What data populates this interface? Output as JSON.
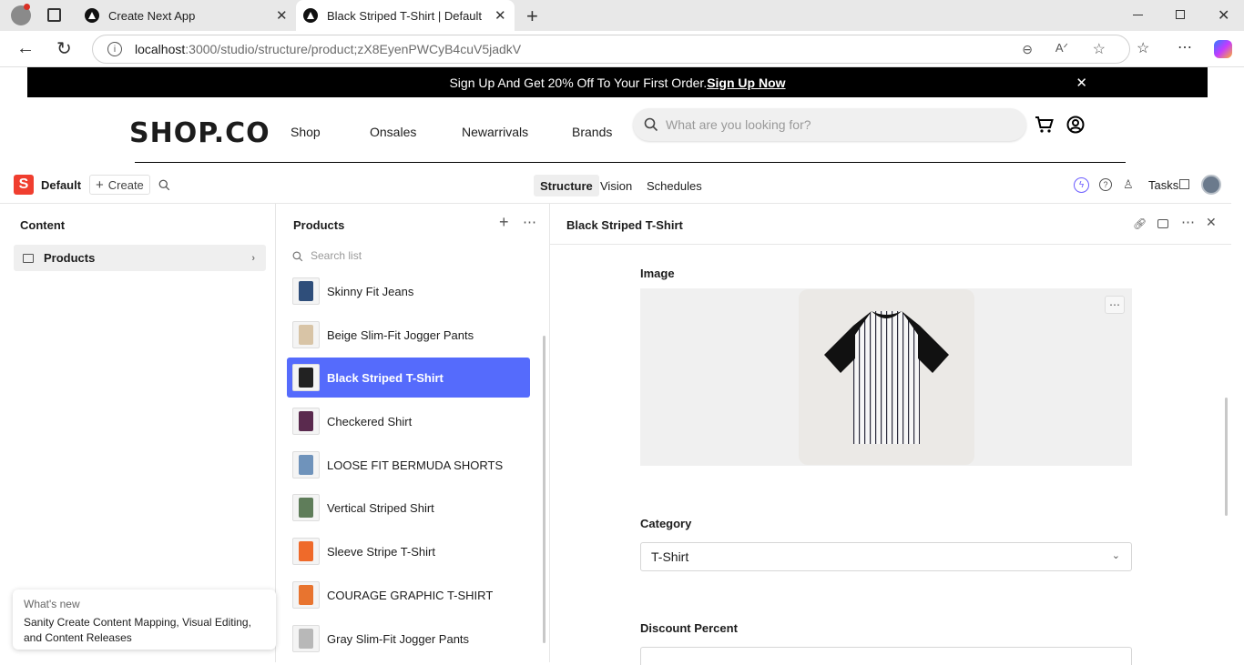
{
  "browser": {
    "tabs": [
      {
        "title": "Create Next App"
      },
      {
        "title": "Black Striped T-Shirt | Default"
      }
    ],
    "url_host": "localhost",
    "url_path": ":3000/studio/structure/product;zX8EyenPWCyB4cuV5jadkV"
  },
  "promo": {
    "text": "Sign Up And Get 20% Off To Your First Order.",
    "link": " Sign Up Now"
  },
  "shop": {
    "logo": "SHOP.CO",
    "nav": [
      "Shop",
      "Onsales",
      "Newarrivals",
      "Brands"
    ],
    "search_placeholder": "What are you looking for?"
  },
  "studio": {
    "workspace": "Default",
    "create_label": "Create",
    "tabs": [
      "Structure",
      "Vision",
      "Schedules"
    ],
    "tasks_label": "Tasks"
  },
  "content_pane": {
    "title": "Content",
    "items": [
      {
        "label": "Products"
      }
    ]
  },
  "products_pane": {
    "title": "Products",
    "search_placeholder": "Search list",
    "items": [
      {
        "label": "Skinny Fit Jeans",
        "thumb_color": "#2f4e7a"
      },
      {
        "label": "Beige Slim-Fit Jogger Pants",
        "thumb_color": "#d8c4a6"
      },
      {
        "label": "Black Striped T-Shirt",
        "thumb_color": "#222222"
      },
      {
        "label": "Checkered Shirt",
        "thumb_color": "#5a2a4e"
      },
      {
        "label": "LOOSE FIT BERMUDA SHORTS",
        "thumb_color": "#6f93bb"
      },
      {
        "label": "Vertical Striped Shirt",
        "thumb_color": "#5f7d5a"
      },
      {
        "label": "Sleeve Stripe T-Shirt",
        "thumb_color": "#ef6a2a"
      },
      {
        "label": "COURAGE GRAPHIC T-SHIRT",
        "thumb_color": "#e8742f"
      },
      {
        "label": "Gray Slim-Fit Jogger Pants",
        "thumb_color": "#b8b8b8"
      }
    ],
    "selected_index": 2
  },
  "document": {
    "title": "Black Striped T-Shirt",
    "image_label": "Image",
    "category_label": "Category",
    "category_value": "T-Shirt",
    "discount_label": "Discount Percent"
  },
  "whats_new": {
    "heading": "What's new",
    "body": "Sanity Create Content Mapping, Visual Editing, and Content Releases"
  },
  "colors": {
    "accent": "#556bfc",
    "brand": "#f03e2f"
  }
}
